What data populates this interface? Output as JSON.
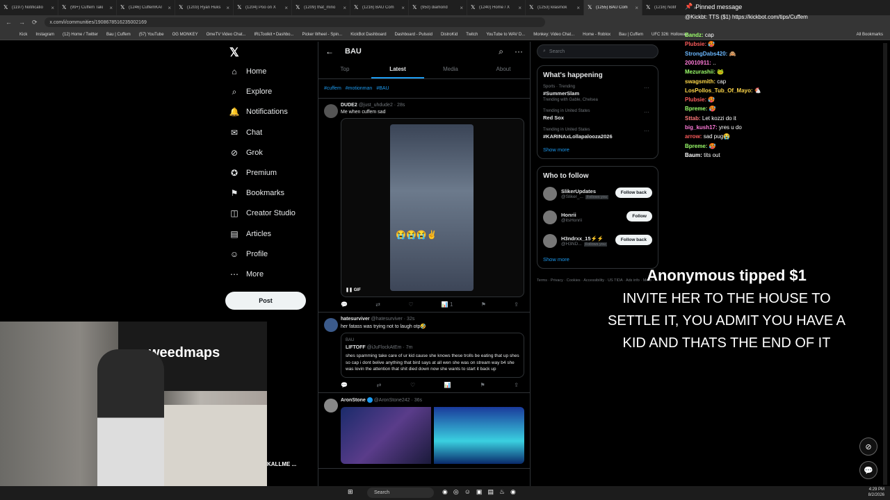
{
  "browser": {
    "tabs": [
      {
        "label": "(1197) Notificatio"
      },
      {
        "label": "(99+) Cuffem Taki"
      },
      {
        "label": "(1246) CuffemKAI"
      },
      {
        "label": "(1203) Ryan Huks"
      },
      {
        "label": "(1204) Poo on X"
      },
      {
        "label": "(1209) that_mino"
      },
      {
        "label": "(1216) BAU Com"
      },
      {
        "label": "(950) diamond"
      },
      {
        "label": "(1240) Home / X"
      },
      {
        "label": "(1253) kilasmok"
      },
      {
        "label": "(1255) BAU Com"
      },
      {
        "label": "(1216) Notif"
      }
    ],
    "url": "x.com/i/communities/1908678516235002169",
    "bookmarks": [
      "Kick",
      "Instagram",
      "(12) Home / Twitter",
      "Bau | Cuffem",
      "(57) YouTube",
      "OG MONKEY",
      "OmeTV Video Chat...",
      "IRLToolkit • Dashbo...",
      "Picker Wheel - Spin...",
      "KickBot Dashboard",
      "Dashboard - Pulsoid",
      "DistroKid",
      "Twitch",
      "YouTube to WAV D...",
      "Monkey: Video Chat...",
      "Home - Roblox",
      "Bau | Cuffem",
      "UFC 326: Holloway..."
    ],
    "all_bookmarks": "All Bookmarks"
  },
  "left_nav": {
    "items": [
      {
        "label": "Home",
        "icon": "home-icon"
      },
      {
        "label": "Explore",
        "icon": "search-icon"
      },
      {
        "label": "Notifications",
        "icon": "bell-icon"
      },
      {
        "label": "Chat",
        "icon": "chat-icon"
      },
      {
        "label": "Grok",
        "icon": "grok-icon"
      },
      {
        "label": "Premium",
        "icon": "premium-icon"
      },
      {
        "label": "Bookmarks",
        "icon": "bookmark-icon"
      },
      {
        "label": "Creator Studio",
        "icon": "studio-icon"
      },
      {
        "label": "Articles",
        "icon": "articles-icon"
      },
      {
        "label": "Profile",
        "icon": "profile-icon"
      },
      {
        "label": "More",
        "icon": "more-icon"
      }
    ],
    "post_label": "Post",
    "account_name": "KALLME ..."
  },
  "feed": {
    "title": "BAU",
    "tabs": [
      "Top",
      "Latest",
      "Media",
      "About"
    ],
    "hashtags": [
      "#cuffem",
      "#motionman",
      "#BAU"
    ],
    "tweets": [
      {
        "name": "DUDE2",
        "handle": "@just_uhdude2 · 28s",
        "text": "Me when cuffem sad",
        "media": "GIF",
        "likes": "1"
      },
      {
        "name": "hatesurviver",
        "handle": "@hatesurviver · 32s",
        "text": "her fatass was trying not to laugh otp🤣",
        "quote_community": "BAU",
        "quote_name": "LIFTOFF",
        "quote_handle": "@iJuFlockAtEm · 7m",
        "quote_text": "shes spamming take care of ur kid cause she knows these trolls be eating that up shes so cap i dont belive anything that bird says at all wen she was on stream way b4 she was lovin the attention that shit died down now she wants to start it back up"
      },
      {
        "name": "AronStone",
        "handle": "@AronStone242 · 36s"
      }
    ]
  },
  "right": {
    "search_placeholder": "Search",
    "happening_title": "What's happening",
    "trends": [
      {
        "ctx": "Sports · Trending",
        "name": "#SummerSlam",
        "sub": "Trending with Gable, Chelsea"
      },
      {
        "ctx": "Trending in United States",
        "name": "Red Sox",
        "sub": ""
      },
      {
        "ctx": "Trending in United States",
        "name": "#KARINAxLollapalooza2026",
        "sub": ""
      }
    ],
    "show_more": "Show more",
    "wtf_title": "Who to follow",
    "follow": [
      {
        "name": "SlikerUpdates",
        "handle": "@Sliker_...",
        "btn": "Follow back",
        "follows_you": "Follows you"
      },
      {
        "name": "Honrii",
        "handle": "@itsHonrii",
        "btn": "Follow",
        "follows_you": ""
      },
      {
        "name": "H3ndrxx_15⚡⚡",
        "handle": "@H3ND...",
        "btn": "Follow back",
        "follows_you": "Follows you"
      }
    ],
    "footer": "Terms · Privacy · Cookies · Accessibility · US TIDA · Ads info · More · ..."
  },
  "chat": {
    "pinned": "Pinned message",
    "pinned_msg": "@Kickbt: TTS ($1) https://kickbot.com/tips/Cuffem",
    "messages": [
      {
        "user": "Bandz:",
        "text": "cap",
        "color": "#9cff6b"
      },
      {
        "user": "Plubsie:",
        "text": "🥵",
        "color": "#ff5c5c"
      },
      {
        "user": "StrongDabs420:",
        "text": "🙈",
        "color": "#6bb8ff"
      },
      {
        "user": "20010911:",
        "text": "..",
        "color": "#ff7ad9"
      },
      {
        "user": "Mezurashii:",
        "text": "🐸",
        "color": "#9cff6b"
      },
      {
        "user": "swagsmith:",
        "text": "cap",
        "color": "#ffd84a"
      },
      {
        "user": "LosPollos_Tub_Of_Mayo:",
        "text": "🐔",
        "color": "#ffd84a"
      },
      {
        "user": "Plubsie:",
        "text": "🥵",
        "color": "#ff5c5c"
      },
      {
        "user": "Bpreme:",
        "text": "🥵",
        "color": "#9cff6b"
      },
      {
        "user": "Sttab:",
        "text": "Let kozzi do it",
        "color": "#ff7a7a"
      },
      {
        "user": "big_kush17:",
        "text": "yres u do",
        "color": "#ff7ad9"
      },
      {
        "user": "arrow:",
        "text": "sad pug😭",
        "color": "#ff5c5c"
      },
      {
        "user": "Bpreme:",
        "text": "🥵",
        "color": "#9cff6b"
      },
      {
        "user": "Baum:",
        "text": "tits out",
        "color": "#ffffff"
      }
    ]
  },
  "tip": {
    "title": "Anonymous tipped $1",
    "text": "INVITE HER TO THE HOUSE TO SETTLE IT, YOU ADMIT YOU HAVE A KID AND THATS THE END OF IT"
  },
  "cam": {
    "banner": "weedmaps"
  },
  "taskbar": {
    "search": "Search",
    "time": "4:29 PM",
    "date": "8/2/2026"
  }
}
